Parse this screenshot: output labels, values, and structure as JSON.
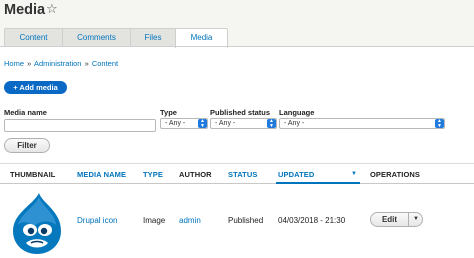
{
  "page": {
    "title": "Media",
    "star_icon": "star-outline-icon"
  },
  "tabs": [
    {
      "label": "Content",
      "active": false
    },
    {
      "label": "Comments",
      "active": false
    },
    {
      "label": "Files",
      "active": false
    },
    {
      "label": "Media",
      "active": true
    }
  ],
  "breadcrumb": {
    "items": [
      "Home",
      "Administration",
      "Content"
    ],
    "separator": "»"
  },
  "actions": {
    "add_media_label": "+ Add media"
  },
  "filters": {
    "media_name_label": "Media name",
    "media_name_value": "",
    "type_label": "Type",
    "type_value": "- Any -",
    "published_label": "Published status",
    "published_value": "- Any -",
    "language_label": "Language",
    "language_value": "- Any -",
    "filter_button": "Filter"
  },
  "table": {
    "columns": [
      "THUMBNAIL",
      "MEDIA NAME",
      "TYPE",
      "AUTHOR",
      "STATUS",
      "UPDATED",
      "OPERATIONS"
    ],
    "sorted_column": "UPDATED",
    "sort_direction": "descending",
    "rows": [
      {
        "thumbnail_icon": "drupal-logo-icon",
        "media_name": "Drupal icon",
        "type": "Image",
        "author": "admin",
        "status": "Published",
        "updated": "04/03/2018 - 21:30",
        "operation": "Edit"
      }
    ]
  },
  "colors": {
    "link": "#0074bd",
    "primary_button": "#0a69c4",
    "drupal_blue": "#0678be"
  }
}
